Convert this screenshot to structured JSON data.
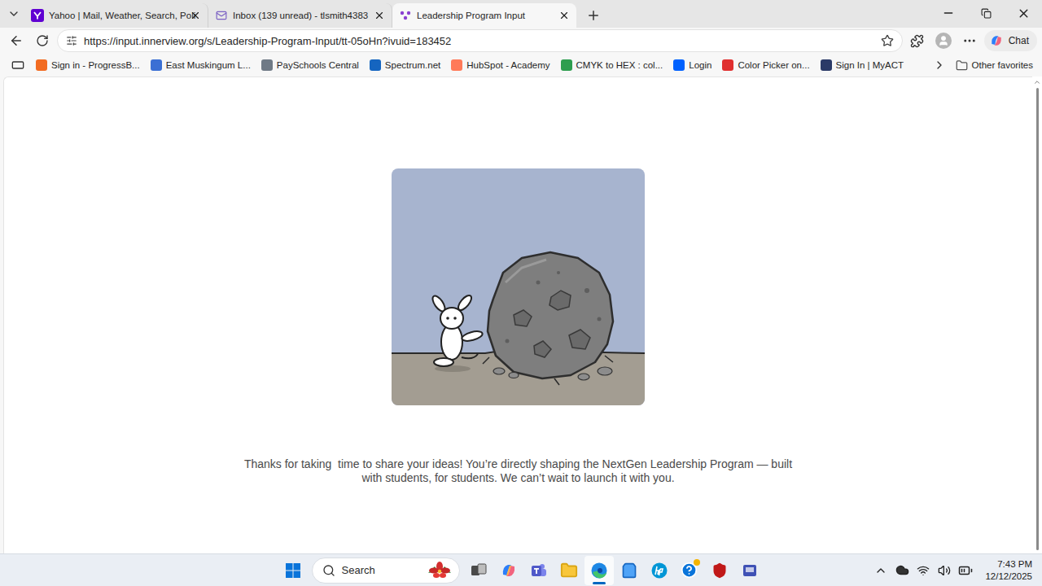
{
  "tabs": [
    {
      "label": "Yahoo | Mail, Weather, Search, Poli",
      "selected": false
    },
    {
      "label": "Inbox (139 unread) - tlsmith4383",
      "selected": false
    },
    {
      "label": "Leadership Program Input",
      "selected": true
    }
  ],
  "address_bar": {
    "url": "https://input.innerview.org/s/Leadership-Program-Input/tt-05oHn?ivuid=183452",
    "favorite": false
  },
  "chat_button": {
    "label": "Chat"
  },
  "bookmarks": [
    {
      "label": "Sign in - ProgressB..."
    },
    {
      "label": "East Muskingum L..."
    },
    {
      "label": "PaySchools Central"
    },
    {
      "label": "Spectrum.net"
    },
    {
      "label": "HubSpot - Academy"
    },
    {
      "label": "CMYK to HEX : col..."
    },
    {
      "label": "Login"
    },
    {
      "label": "Color Picker on..."
    },
    {
      "label": "Sign In | MyACT"
    }
  ],
  "other_favorites": {
    "label": "Other favorites"
  },
  "page": {
    "message": "Thanks for taking  time to share your ideas! You’re directly shaping the NextGen Leadership Program — built with students, for students. We can’t wait to launch it with you."
  },
  "taskbar": {
    "search_placeholder": "Search",
    "apps": [
      {
        "selected": false
      },
      {
        "selected": false
      },
      {
        "selected": false
      },
      {
        "selected": false
      },
      {
        "selected": true
      },
      {
        "selected": false
      },
      {
        "selected": false
      },
      {
        "selected": false
      },
      {
        "selected": false
      },
      {
        "selected": false
      }
    ],
    "time": "7:43 PM",
    "date": "12/12/2025"
  }
}
